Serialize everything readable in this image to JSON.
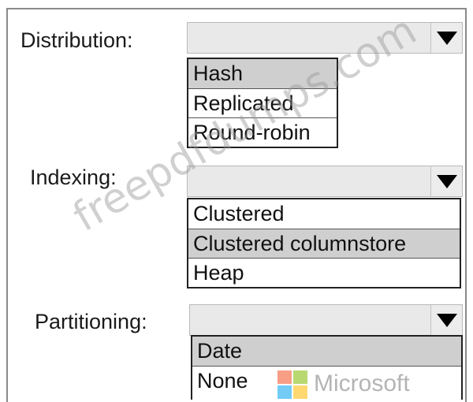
{
  "fields": [
    {
      "label": "Distribution:",
      "options": [
        "Hash",
        "Replicated",
        "Round-robin"
      ],
      "selected_index": 0
    },
    {
      "label": "Indexing:",
      "options": [
        "Clustered",
        "Clustered columnstore",
        "Heap"
      ],
      "selected_index": 1
    },
    {
      "label": "Partitioning:",
      "options": [
        "Date",
        "None"
      ],
      "selected_index": 0
    }
  ],
  "watermark": {
    "text": "freepdfdumps.com",
    "brand": "Microsoft",
    "logo_colors": [
      "#f25022",
      "#7fba00",
      "#00a4ef",
      "#ffb900"
    ]
  },
  "icons": {
    "dropdown": "triangle-down-icon",
    "brand_logo": "microsoft-logo-icon"
  }
}
